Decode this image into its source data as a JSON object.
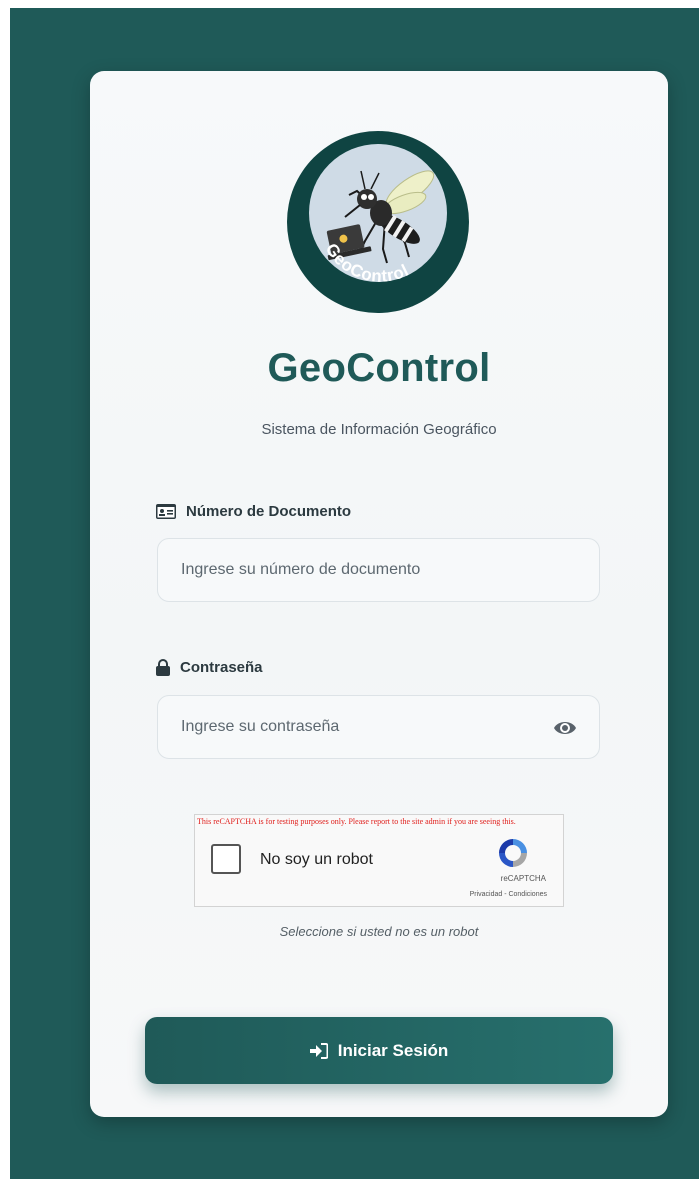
{
  "brand": {
    "logo_text": "GeoControl",
    "title": "GeoControl",
    "subtitle": "Sistema de Información Geográfico"
  },
  "form": {
    "document": {
      "label": "Número de Documento",
      "placeholder": "Ingrese su número de documento",
      "value": "",
      "icon": "id-card-icon"
    },
    "password": {
      "label": "Contraseña",
      "placeholder": "Ingrese su contraseña",
      "value": "",
      "icon": "lock-icon",
      "toggle_icon": "eye-icon"
    },
    "recaptcha": {
      "warning": "This reCAPTCHA is for testing purposes only. Please report to the site admin if you are seeing this.",
      "checkbox_label": "No soy un robot",
      "brand": "reCAPTCHA",
      "links": "Privacidad - Condiciones",
      "hint": "Seleccione si usted no es un robot",
      "checked": false
    },
    "submit": {
      "label": "Iniciar Sesión",
      "icon": "sign-in-icon"
    }
  },
  "colors": {
    "primary": "#1f5a58",
    "primary_light": "#27706d",
    "card_bg": "#f5f7f8",
    "recaptcha_warning": "#e0201d"
  }
}
